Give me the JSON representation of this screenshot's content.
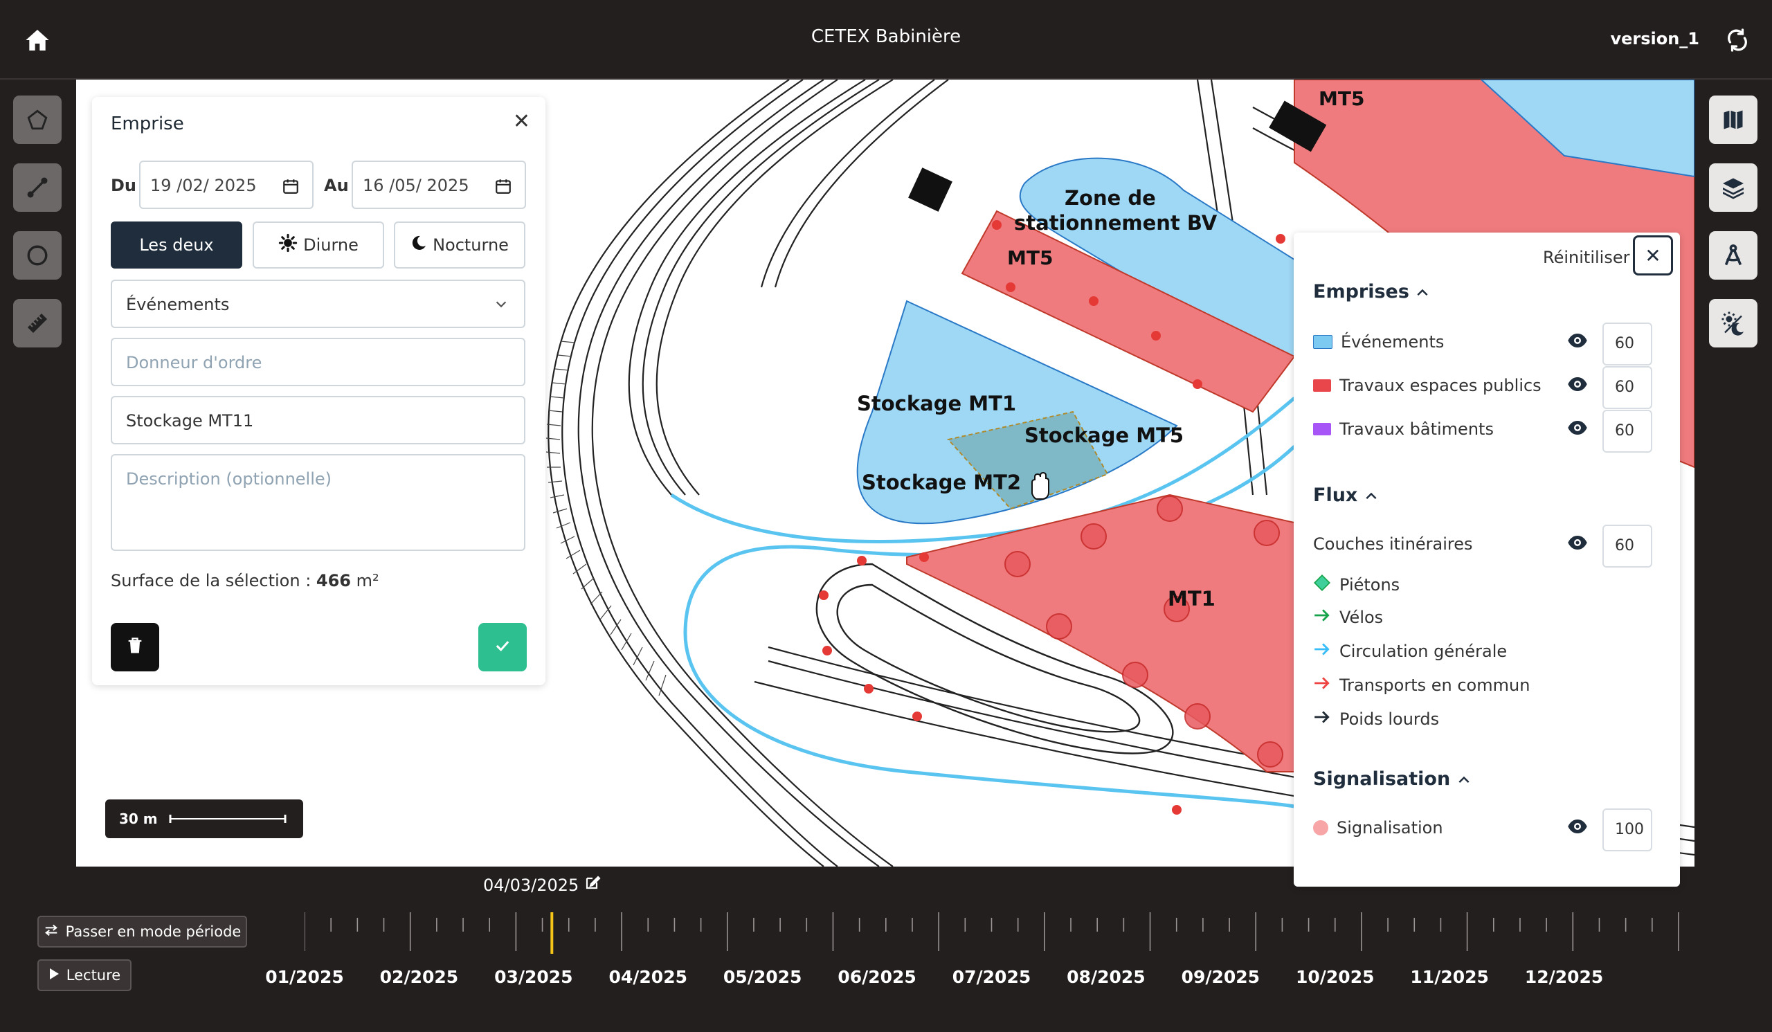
{
  "header": {
    "title": "CETEX Babinière",
    "version": "version_1"
  },
  "left_tools": [
    {
      "name": "polygon-tool-icon"
    },
    {
      "name": "line-tool-icon"
    },
    {
      "name": "circle-tool-icon"
    },
    {
      "name": "ruler-tool-icon"
    }
  ],
  "right_tools": [
    {
      "name": "map-icon"
    },
    {
      "name": "layers-icon"
    },
    {
      "name": "compass-draw-icon"
    },
    {
      "name": "day-night-icon"
    }
  ],
  "emprise": {
    "title": "Emprise",
    "from_label": "Du",
    "from_date": "19 /02/ 2025",
    "to_label": "Au",
    "to_date": "16 /05/ 2025",
    "segments": [
      "Les deux",
      "Diurne",
      "Nocturne"
    ],
    "active_segment": "Les deux",
    "category": "Événements",
    "donneur_placeholder": "Donneur d'ordre",
    "name_value": "Stockage MT11",
    "description_placeholder": "Description (optionnelle)",
    "surface_label": "Surface de la sélection : ",
    "surface_value": "466",
    "surface_unit": "m²"
  },
  "map": {
    "labels": [
      "MT5",
      "Zone de",
      "stationnement BV",
      "MT5",
      "Stockage MT1",
      "Stockage MT5",
      "Stockage MT2",
      "MT1"
    ],
    "scale": "30 m"
  },
  "legend": {
    "reset": "Réinitiliser",
    "sections": {
      "emprises": {
        "title": "Emprises",
        "items": [
          {
            "label": "Événements",
            "color": "#7cc9f2",
            "opacity": "60"
          },
          {
            "label": "Travaux espaces publics",
            "color": "#e8464b",
            "opacity": "60"
          },
          {
            "label": "Travaux bâtiments",
            "color": "#a855f7",
            "opacity": "60"
          }
        ]
      },
      "flux": {
        "title": "Flux",
        "layer": {
          "label": "Couches itinéraires",
          "opacity": "60"
        },
        "items": [
          {
            "label": "Piétons",
            "color": "#3ecf9a"
          },
          {
            "label": "Vélos",
            "color": "#16a34a"
          },
          {
            "label": "Circulation générale",
            "color": "#38bdf8"
          },
          {
            "label": "Transports en commun",
            "color": "#ef4444"
          },
          {
            "label": "Poids lourds",
            "color": "#1f2933"
          }
        ]
      },
      "signalisation": {
        "title": "Signalisation",
        "items": [
          {
            "label": "Signalisation",
            "color": "#f8a5a7",
            "opacity": "100"
          }
        ]
      }
    }
  },
  "timeline": {
    "current_date": "04/03/2025",
    "mode_button": "Passer en mode période",
    "play_button": "Lecture",
    "current_fraction": 0.18,
    "months": [
      "01/2025",
      "02/2025",
      "03/2025",
      "04/2025",
      "05/2025",
      "06/2025",
      "07/2025",
      "08/2025",
      "09/2025",
      "10/2025",
      "11/2025",
      "12/2025"
    ]
  },
  "colors": {
    "dark": "#231f1e",
    "navy": "#1f2d3d",
    "confirm": "#2dbf8f",
    "timeline_cursor": "#f5c518"
  }
}
